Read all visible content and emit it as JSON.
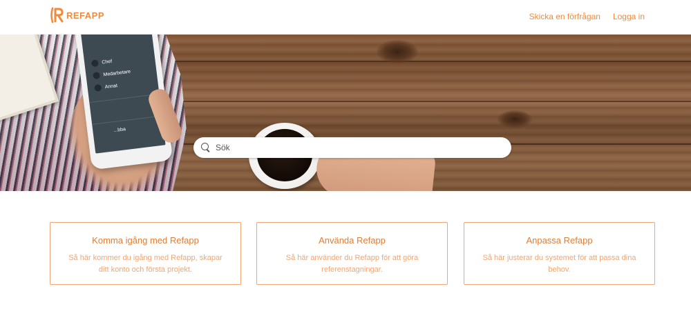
{
  "header": {
    "logo_text": "REFAPP",
    "nav": [
      {
        "label": "Skicka en förfrågan"
      },
      {
        "label": "Logga in"
      }
    ]
  },
  "hero": {
    "phone_options": [
      "Chef",
      "Medarbetare",
      "Annat"
    ],
    "phone_footer": "...bba",
    "search": {
      "placeholder": "Sök",
      "value": ""
    }
  },
  "cards": [
    {
      "title": "Komma igång med Refapp",
      "description": "Så här kommer du igång med Refapp, skapar ditt konto och första projekt."
    },
    {
      "title": "Använda Refapp",
      "description": "Så här använder du Refapp för att göra referenstagningar."
    },
    {
      "title": "Anpassa Refapp",
      "description": "Så här justerar du systemet för att passa dina behov."
    }
  ],
  "colors": {
    "accent": "#f08a3c",
    "card_border": "#f0a673",
    "card_title": "#e07d35"
  },
  "icons": {
    "logo": "refapp-r-logo-icon",
    "search": "search-icon"
  }
}
